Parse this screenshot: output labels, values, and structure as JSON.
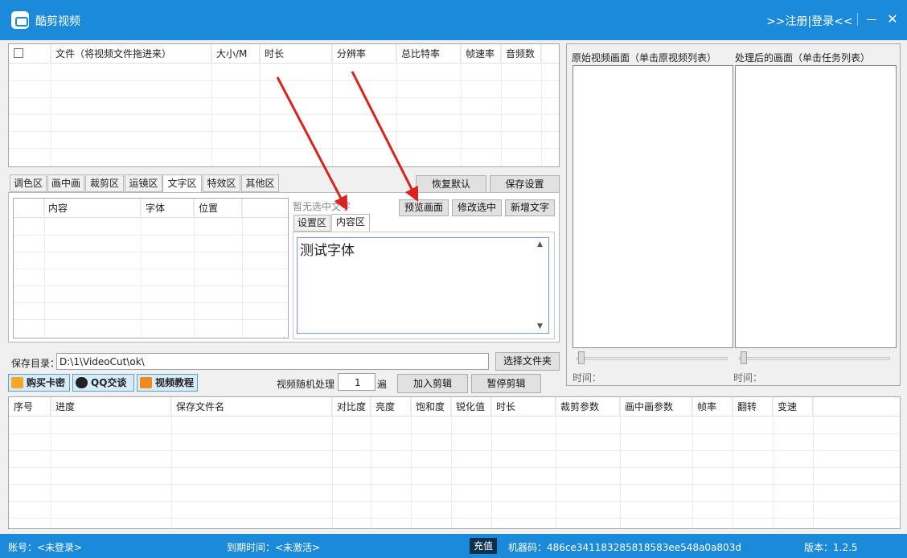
{
  "window": {
    "title": "酷剪视频",
    "login_link": ">>注册|登录<<",
    "close_glyph": "✕"
  },
  "file_table": {
    "columns": [
      "文件（将视频文件拖进来）",
      "大小/M",
      "时长",
      "分辨率",
      "总比特率",
      "帧速率",
      "音频数"
    ]
  },
  "preview": {
    "original_label": "原始视频画面（单击原视频列表）",
    "processed_label": "处理后的画面（单击任务列表）",
    "time_label_left": "时间：",
    "time_label_right": "时间："
  },
  "tabs": [
    "调色区",
    "画中画",
    "裁剪区",
    "运镜区",
    "文字区",
    "特效区",
    "其他区"
  ],
  "active_tab": "文字区",
  "actions": {
    "restore_default": "恢复默认",
    "save_settings": "保存设置"
  },
  "text_list": {
    "columns": [
      "内容",
      "字体",
      "位置"
    ]
  },
  "text_editor": {
    "status": "暂无选中文字",
    "preview_button": "预览画面",
    "modify_button": "修改选中",
    "add_button": "新增文字",
    "subtabs": [
      "设置区",
      "内容区"
    ],
    "active_subtab": "内容区",
    "content": "测试字体"
  },
  "save_dir": {
    "label": "保存目录：",
    "value": "D:\\1\\VideoCut\\ok\\",
    "choose_button": "选择文件夹"
  },
  "promo_buttons": {
    "buy": "购买卡密",
    "qq": "QQ交谈",
    "tutorial": "视频教程"
  },
  "random": {
    "label": "视频随机处理",
    "value": "1",
    "unit": "遍"
  },
  "clip_buttons": {
    "add": "加入剪辑",
    "pause": "暂停剪辑"
  },
  "task_table": {
    "columns": [
      "序号",
      "进度",
      "保存文件名",
      "对比度",
      "亮度",
      "饱和度",
      "锐化值",
      "时长",
      "裁剪参数",
      "画中画参数",
      "帧率",
      "翻转",
      "变速"
    ]
  },
  "statusbar": {
    "account": "账号：<未登录>",
    "expiry": "到期时间：<未激活>",
    "recharge": "充值",
    "machine_code": "机器码：486ce341183285818583ee548a0a803d",
    "version": "版本：1.2.5"
  },
  "colors": {
    "titlebar": "#1b8ad8",
    "annotation_arrow": "#d9231d"
  }
}
